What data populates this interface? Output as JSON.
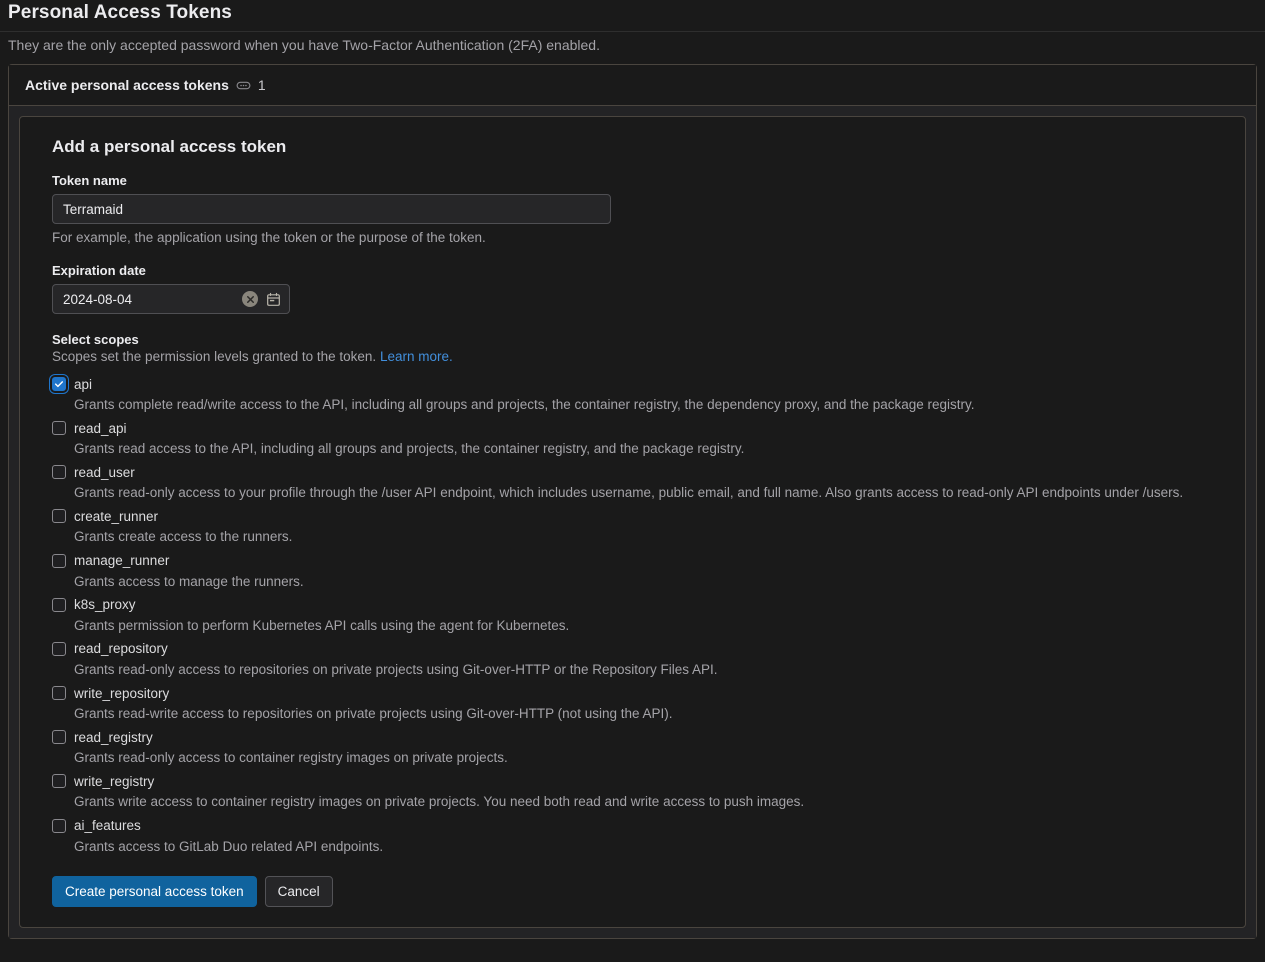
{
  "header": {
    "title": "Personal Access Tokens",
    "subtitle": "They are the only accepted password when you have Two-Factor Authentication (2FA) enabled."
  },
  "active_tokens_card": {
    "title": "Active personal access tokens",
    "icon": "token-oval-icon",
    "count": "1"
  },
  "form": {
    "title": "Add a personal access token",
    "token_name": {
      "label": "Token name",
      "value": "Terramaid",
      "placeholder": "",
      "help": "For example, the application using the token or the purpose of the token."
    },
    "expiration_date": {
      "label": "Expiration date",
      "value": "2024-08-04",
      "placeholder": "YYYY-MM-DD",
      "clear_icon": "clear-circle-x-icon",
      "calendar_icon": "calendar-icon"
    },
    "scopes": {
      "label": "Select scopes",
      "help_text": "Scopes set the permission levels granted to the token.",
      "help_link": "Learn more.",
      "items": [
        {
          "name": "api",
          "checked": true,
          "description": "Grants complete read/write access to the API, including all groups and projects, the container registry, the dependency proxy, and the package registry."
        },
        {
          "name": "read_api",
          "checked": false,
          "description": "Grants read access to the API, including all groups and projects, the container registry, and the package registry."
        },
        {
          "name": "read_user",
          "checked": false,
          "description": "Grants read-only access to your profile through the /user API endpoint, which includes username, public email, and full name. Also grants access to read-only API endpoints under /users."
        },
        {
          "name": "create_runner",
          "checked": false,
          "description": "Grants create access to the runners."
        },
        {
          "name": "manage_runner",
          "checked": false,
          "description": "Grants access to manage the runners."
        },
        {
          "name": "k8s_proxy",
          "checked": false,
          "description": "Grants permission to perform Kubernetes API calls using the agent for Kubernetes."
        },
        {
          "name": "read_repository",
          "checked": false,
          "description": "Grants read-only access to repositories on private projects using Git-over-HTTP or the Repository Files API."
        },
        {
          "name": "write_repository",
          "checked": false,
          "description": "Grants read-write access to repositories on private projects using Git-over-HTTP (not using the API)."
        },
        {
          "name": "read_registry",
          "checked": false,
          "description": "Grants read-only access to container registry images on private projects."
        },
        {
          "name": "write_registry",
          "checked": false,
          "description": "Grants write access to container registry images on private projects. You need both read and write access to push images."
        },
        {
          "name": "ai_features",
          "checked": false,
          "description": "Grants access to GitLab Duo related API endpoints."
        }
      ]
    },
    "submit_label": "Create personal access token",
    "cancel_label": "Cancel"
  },
  "colors": {
    "page_background": "#1a1a1a",
    "accent_blue": "#1f75cb",
    "primary_button": "#10639e",
    "link_blue": "#428fdc",
    "border": "#4a453f",
    "muted_text": "#a4a3a8"
  }
}
